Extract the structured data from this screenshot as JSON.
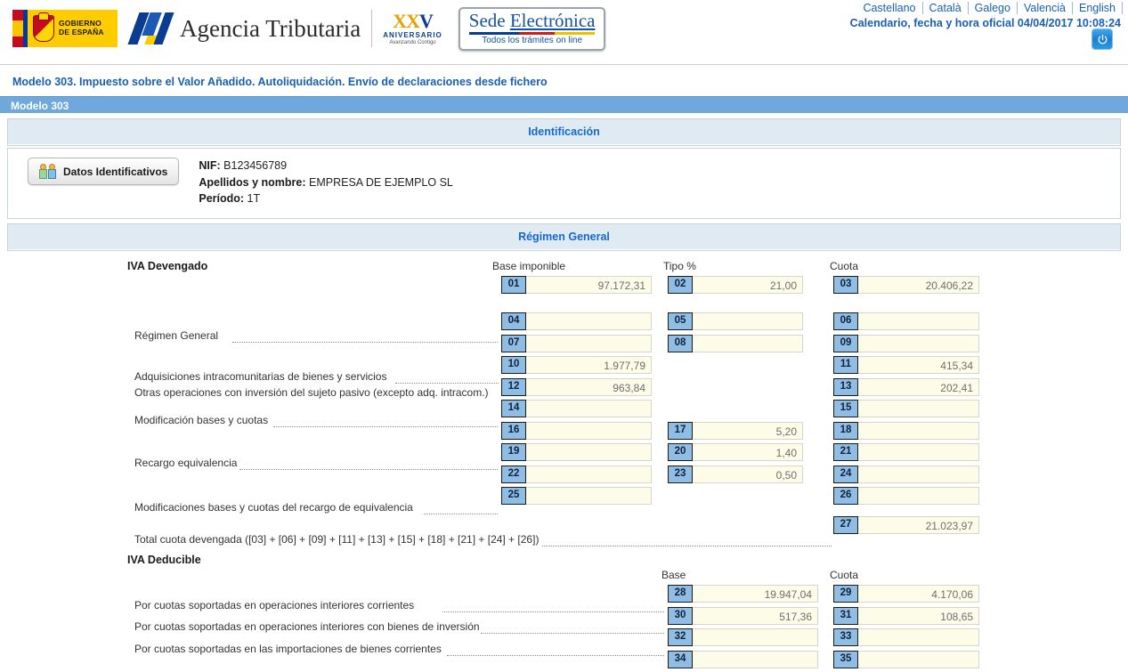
{
  "header": {
    "gob_line1": "GOBIERNO",
    "gob_line2": "DE ESPAÑA",
    "agency_name": "Agencia Tributaria",
    "anniversary_x": "XX",
    "anniversary_v": "V",
    "anniversary_label": "ANIVERSARIO",
    "anniversary_tagline": "Avanzando Contigo",
    "sede_word1": "Sede ",
    "sede_word2": "Electrónica",
    "sede_tagline": "Todos los trámites on line",
    "languages": [
      "Castellano",
      "Català",
      "Galego",
      "Valencià",
      "English"
    ],
    "datetime_label": "Calendario, fecha y hora oficial 04/04/2017 10:08:24",
    "power_icon": "power-icon"
  },
  "page": {
    "title": "Modelo 303. Impuesto sobre el Valor Añadido. Autoliquidación. Envío de declaraciones desde fichero",
    "model_bar": "Modelo 303"
  },
  "identificacion": {
    "section_title": "Identificación",
    "button_label": "Datos Identificativos",
    "button_icon": "users-icon",
    "nif_label": "NIF:",
    "nif_value": "B123456789",
    "name_label": "Apellidos y nombre:",
    "name_value": "EMPRESA DE EJEMPLO SL",
    "periodo_label": "Período:",
    "periodo_value": "1T"
  },
  "regimen_general": {
    "section_title": "Régimen General",
    "devengado_title": "IVA Devengado",
    "deducible_title": "IVA Deducible",
    "col_base_imponible": "Base imponible",
    "col_tipo": "Tipo %",
    "col_cuota": "Cuota",
    "col_base": "Base",
    "labels": {
      "regimen_general": "Régimen General",
      "adquisiciones": "Adquisiciones intracomunitarias de bienes y servicios",
      "otras_operaciones": "Otras operaciones con inversión del sujeto pasivo (excepto adq. intracom.)",
      "modificacion": "Modificación bases y cuotas",
      "recargo": "Recargo equivalencia",
      "modificaciones_recargo": "Modificaciones bases y cuotas del recargo de equivalencia",
      "total_cuota": "Total cuota devengada ([03] + [06] + [09] + [11] + [13] + [15] + [18] + [21] + [24] + [26])",
      "interiores_corrientes": "Por cuotas soportadas en operaciones interiores corrientes",
      "interiores_inversion": "Por cuotas soportadas en operaciones interiores con bienes de inversión",
      "importaciones_corrientes": "Por cuotas soportadas en las importaciones de bienes corrientes"
    },
    "boxes": {
      "01": "97.172,31",
      "02": "21,00",
      "03": "20.406,22",
      "04": "",
      "05": "",
      "06": "",
      "07": "",
      "08": "",
      "09": "",
      "10": "1.977,79",
      "11": "415,34",
      "12": "963,84",
      "13": "202,41",
      "14": "",
      "15": "",
      "16": "",
      "17": "5,20",
      "18": "",
      "19": "",
      "20": "1,40",
      "21": "",
      "22": "",
      "23": "0,50",
      "24": "",
      "25": "",
      "26": "",
      "27": "21.023,97",
      "28": "19.947,04",
      "29": "4.170,06",
      "30": "517,36",
      "31": "108,65",
      "32": "",
      "33": "",
      "34": "",
      "35": ""
    },
    "box_numbers": {
      "n01": "01",
      "n02": "02",
      "n03": "03",
      "n04": "04",
      "n05": "05",
      "n06": "06",
      "n07": "07",
      "n08": "08",
      "n09": "09",
      "n10": "10",
      "n11": "11",
      "n12": "12",
      "n13": "13",
      "n14": "14",
      "n15": "15",
      "n16": "16",
      "n17": "17",
      "n18": "18",
      "n19": "19",
      "n20": "20",
      "n21": "21",
      "n22": "22",
      "n23": "23",
      "n24": "24",
      "n25": "25",
      "n26": "26",
      "n27": "27",
      "n28": "28",
      "n29": "29",
      "n30": "30",
      "n31": "31",
      "n32": "32",
      "n33": "33",
      "n34": "34",
      "n35": "35"
    }
  },
  "colors": {
    "accent_blue": "#1a5fb4",
    "bar_blue": "#6fa8dc",
    "panel_head": "#dfeaf2",
    "box_blue": "#8fbde4",
    "field_bg": "#fdfce8"
  }
}
